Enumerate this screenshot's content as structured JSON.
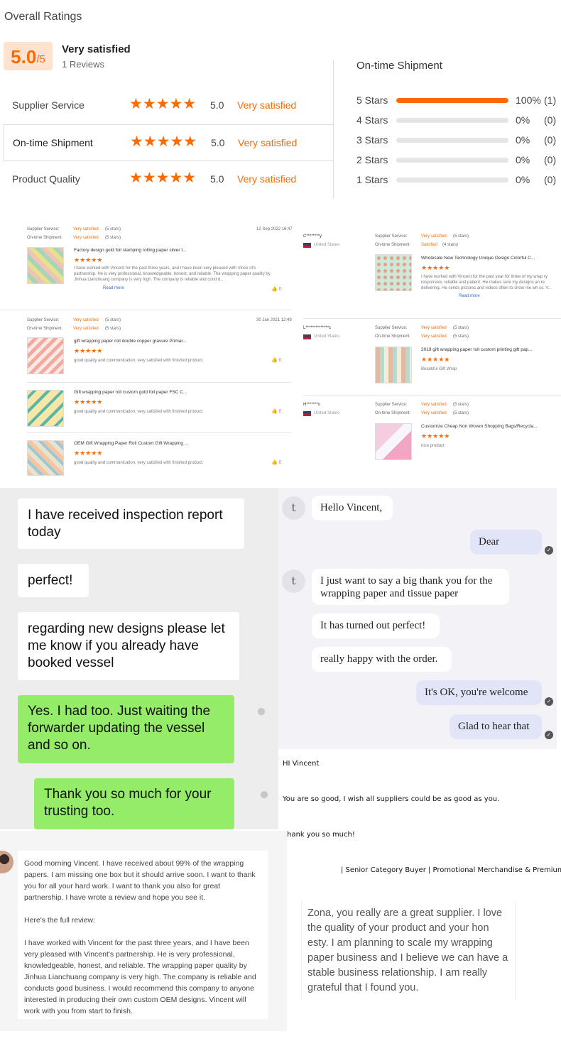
{
  "ratings": {
    "title": "Overall Ratings",
    "score": "5.0",
    "score_max": "/5",
    "summary": "Very satisfied",
    "reviews": "1 Reviews",
    "rows": [
      {
        "label": "Supplier Service",
        "stars": "★★★★★",
        "value": "5.0",
        "text": "Very satisfied"
      },
      {
        "label": "On-time Shipment",
        "stars": "★★★★★",
        "value": "5.0",
        "text": "Very satisfied"
      },
      {
        "label": "Product Quality",
        "stars": "★★★★★",
        "value": "5.0",
        "text": "Very satisfied"
      }
    ],
    "shipment": {
      "title": "On-time Shipment",
      "bars": [
        {
          "label": "5  Stars",
          "pct": "100%",
          "count": "(1)",
          "fraction": 1.0
        },
        {
          "label": "4  Stars",
          "pct": "0%",
          "count": "(0)",
          "fraction": 0
        },
        {
          "label": "3  Stars",
          "pct": "0%",
          "count": "(0)",
          "fraction": 0
        },
        {
          "label": "2  Stars",
          "pct": "0%",
          "count": "(0)",
          "fraction": 0
        },
        {
          "label": "1  Stars",
          "pct": "0%",
          "count": "(0)",
          "fraction": 0
        }
      ]
    }
  },
  "reviews_left": [
    {
      "supplier_label": "Supplier Service:",
      "supplier_val": "Very satisfied",
      "supplier_stars": "(5 stars)",
      "ship_label": "On-time Shipment:",
      "ship_val": "Very satisfied",
      "ship_stars": "(5 stars)",
      "date": "12 Sep 2022 16:47",
      "title": "Factory design gold foil stamping rolling paper silver t...",
      "stars": "★★★★★",
      "body": "I have worked with Vincent for the past three years, and I have been very pleased with Vince nt's partnership. He is very professional, knowledgeable, honest, and reliable. The wrapping paper quality by Jinhua Lianchuang company is very high. The company is reliable and cond d...",
      "read_more": "Read more",
      "likes": "0"
    },
    {
      "supplier_label": "Supplier Service:",
      "supplier_val": "Very satisfied",
      "supplier_stars": "(5 stars)",
      "ship_label": "On-time Shipment:",
      "ship_val": "Very satisfied",
      "ship_stars": "(5 stars)",
      "date": "30 Jan 2021 12:49",
      "title": "gift wrapping paper roll double copper gravure Primar...",
      "stars": "★★★★★",
      "body": "good quality and communication. very satisfied with finished product.",
      "likes": "0"
    },
    {
      "title": "Gift wrapping paper roll custom gold foil paper FSC C...",
      "stars": "★★★★★",
      "body": "good quality and communication. very satisfied with finished product.",
      "likes": "0"
    },
    {
      "title": "OEM Gift Wrapping Paper Roll Custom Gift Wrapping ...",
      "stars": "★★★★★",
      "body": "good quality and communication. very satisfied with finished product.",
      "likes": "0"
    }
  ],
  "reviews_right": [
    {
      "user": "C********y",
      "country": "United States",
      "supplier_label": "Supplier Service:",
      "supplier_val": "Very satisfied",
      "supplier_stars": "(5 stars)",
      "ship_label": "On-time Shipment:",
      "ship_val": "Satisfied",
      "ship_stars": "(4 stars)",
      "title": "Wholesale New Technology Unique Design Colorful C...",
      "stars": "★★★★★",
      "body": "I have worked with Vincent for the past year for three of my wrap ry responsive, reliable and patient. He makes sure my designs an re delivering. He sends pictures and videos often to show me wh ss. V...",
      "read_more": "Read more"
    },
    {
      "user": "L**************c",
      "country": "United States",
      "supplier_label": "Supplier Service:",
      "supplier_val": "Very satisfied",
      "supplier_stars": "(5 stars)",
      "ship_label": "On-time Shipment:",
      "ship_val": "Very satisfied",
      "ship_stars": "(5 stars)",
      "title": "2019 gift wrapping paper roll custom printing gift pap...",
      "stars": "★★★★★",
      "body": "Beautiful Gift Wrap"
    },
    {
      "user": "H*******o",
      "country": "United States",
      "supplier_label": "Supplier Service:",
      "supplier_val": "Very satisfied",
      "supplier_stars": "(5 stars)",
      "ship_label": "On-time Shipment:",
      "ship_val": "Very satisfied",
      "ship_stars": "(5 stars)",
      "title": "Customize Cheap Non Woven Shopping Bags/Recycla...",
      "stars": "★★★★★",
      "body": "nice product"
    }
  ],
  "chat_left": {
    "msg1": "I have received inspection report today",
    "msg2": "perfect!",
    "msg3": "regarding new designs please let me know if you already have booked vessel",
    "msg4": "Yes. I had too. Just waiting the forwarder updating the vessel and so on.",
    "msg5": "Thank you so much for your trusting too."
  },
  "chat_right": {
    "avatar_letter": "t",
    "msg1": "Hello Vincent,",
    "msg2": "Dear",
    "msg3": "I just want to say a big thank you for the wrapping paper and tissue paper",
    "msg4": "It has turned out perfect!",
    "msg5": "really happy with the order.",
    "msg6": "It's OK, you're welcome",
    "msg7": "Glad to hear that"
  },
  "email": {
    "line1": "HI Vincent",
    "line2": "You are so good, I wish all suppliers could be as good as you.",
    "line3": "Thank you so much!",
    "signature": "| Senior Category Buyer | Promotional Merchandise & Premiums | Le"
  },
  "review_card": {
    "p1": "Good morning Vincent. I have received about 99% of the wrapping papers. I am missing one box but it should arrive soon. I want to thank you for all your hard work. I want to thank you also for great partnership. I have wrote a review and hope you see it.",
    "p2": "Here's the full review:",
    "p3": "I have worked with Vincent for the past three years, and I have been very pleased with Vincent's partnership. He is very professional, knowledgeable, honest, and reliable. The wrapping paper quality by Jinhua Lianchuang company is very high. The company is reliable and conducts good business. I would recommend this company to anyone interested in producing their own custom OEM designs. Vincent will work with you from start to finish."
  },
  "zona_card": {
    "text": "Zona, you really are a great supplier. I love the quality of your product and your hon esty. I am planning to scale my wrapping paper business and I believe we can have a stable business relationship. I am really grateful that I found you."
  },
  "colors": {
    "accent": "#ff6a00",
    "wechat_green": "#95ec69",
    "chat_bg": "#ededed"
  }
}
